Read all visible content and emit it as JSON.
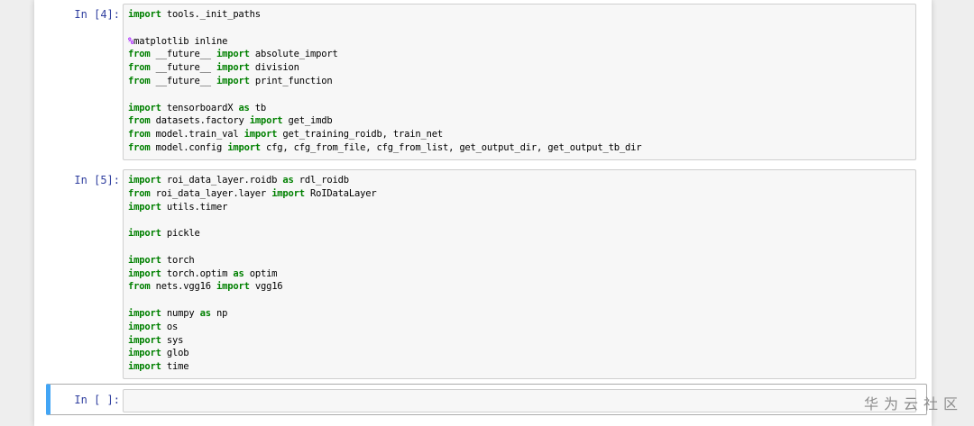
{
  "cells": [
    {
      "prompt": "In  [4]:",
      "lines": [
        [
          [
            "kw",
            "import"
          ],
          [
            "t",
            " tools._init_paths"
          ]
        ],
        [],
        [
          [
            "mg",
            "%"
          ],
          [
            "t",
            "matplotlib inline"
          ]
        ],
        [
          [
            "kw",
            "from"
          ],
          [
            "t",
            " __future__ "
          ],
          [
            "kw",
            "import"
          ],
          [
            "t",
            " absolute_import"
          ]
        ],
        [
          [
            "kw",
            "from"
          ],
          [
            "t",
            " __future__ "
          ],
          [
            "kw",
            "import"
          ],
          [
            "t",
            " division"
          ]
        ],
        [
          [
            "kw",
            "from"
          ],
          [
            "t",
            " __future__ "
          ],
          [
            "kw",
            "import"
          ],
          [
            "t",
            " print_function"
          ]
        ],
        [],
        [
          [
            "kw",
            "import"
          ],
          [
            "t",
            " tensorboardX "
          ],
          [
            "kw",
            "as"
          ],
          [
            "t",
            " tb"
          ]
        ],
        [
          [
            "kw",
            "from"
          ],
          [
            "t",
            " datasets.factory "
          ],
          [
            "kw",
            "import"
          ],
          [
            "t",
            " get_imdb"
          ]
        ],
        [
          [
            "kw",
            "from"
          ],
          [
            "t",
            " model.train_val "
          ],
          [
            "kw",
            "import"
          ],
          [
            "t",
            " get_training_roidb, train_net"
          ]
        ],
        [
          [
            "kw",
            "from"
          ],
          [
            "t",
            " model.config "
          ],
          [
            "kw",
            "import"
          ],
          [
            "t",
            " cfg, cfg_from_file, cfg_from_list, get_output_dir, get_output_tb_dir"
          ]
        ]
      ]
    },
    {
      "prompt": "In  [5]:",
      "lines": [
        [
          [
            "kw",
            "import"
          ],
          [
            "t",
            " roi_data_layer.roidb "
          ],
          [
            "kw",
            "as"
          ],
          [
            "t",
            " rdl_roidb"
          ]
        ],
        [
          [
            "kw",
            "from"
          ],
          [
            "t",
            " roi_data_layer.layer "
          ],
          [
            "kw",
            "import"
          ],
          [
            "t",
            " RoIDataLayer"
          ]
        ],
        [
          [
            "kw",
            "import"
          ],
          [
            "t",
            " utils.timer"
          ]
        ],
        [],
        [
          [
            "kw",
            "import"
          ],
          [
            "t",
            " pickle"
          ]
        ],
        [],
        [
          [
            "kw",
            "import"
          ],
          [
            "t",
            " torch"
          ]
        ],
        [
          [
            "kw",
            "import"
          ],
          [
            "t",
            " torch.optim "
          ],
          [
            "kw",
            "as"
          ],
          [
            "t",
            " optim"
          ]
        ],
        [
          [
            "kw",
            "from"
          ],
          [
            "t",
            " nets.vgg16 "
          ],
          [
            "kw",
            "import"
          ],
          [
            "t",
            " vgg16"
          ]
        ],
        [],
        [
          [
            "kw",
            "import"
          ],
          [
            "t",
            " numpy "
          ],
          [
            "kw",
            "as"
          ],
          [
            "t",
            " np"
          ]
        ],
        [
          [
            "kw",
            "import"
          ],
          [
            "t",
            " os"
          ]
        ],
        [
          [
            "kw",
            "import"
          ],
          [
            "t",
            " sys"
          ]
        ],
        [
          [
            "kw",
            "import"
          ],
          [
            "t",
            " glob"
          ]
        ],
        [
          [
            "kw",
            "import"
          ],
          [
            "t",
            " time"
          ]
        ]
      ]
    },
    {
      "prompt": "In  [ ]:",
      "lines": []
    }
  ],
  "watermark": "华为云社区",
  "colors": {
    "keyword": "#008000",
    "magic": "#aa22ff",
    "prompt": "#303f9f",
    "selected_border": "#42a5f5"
  }
}
